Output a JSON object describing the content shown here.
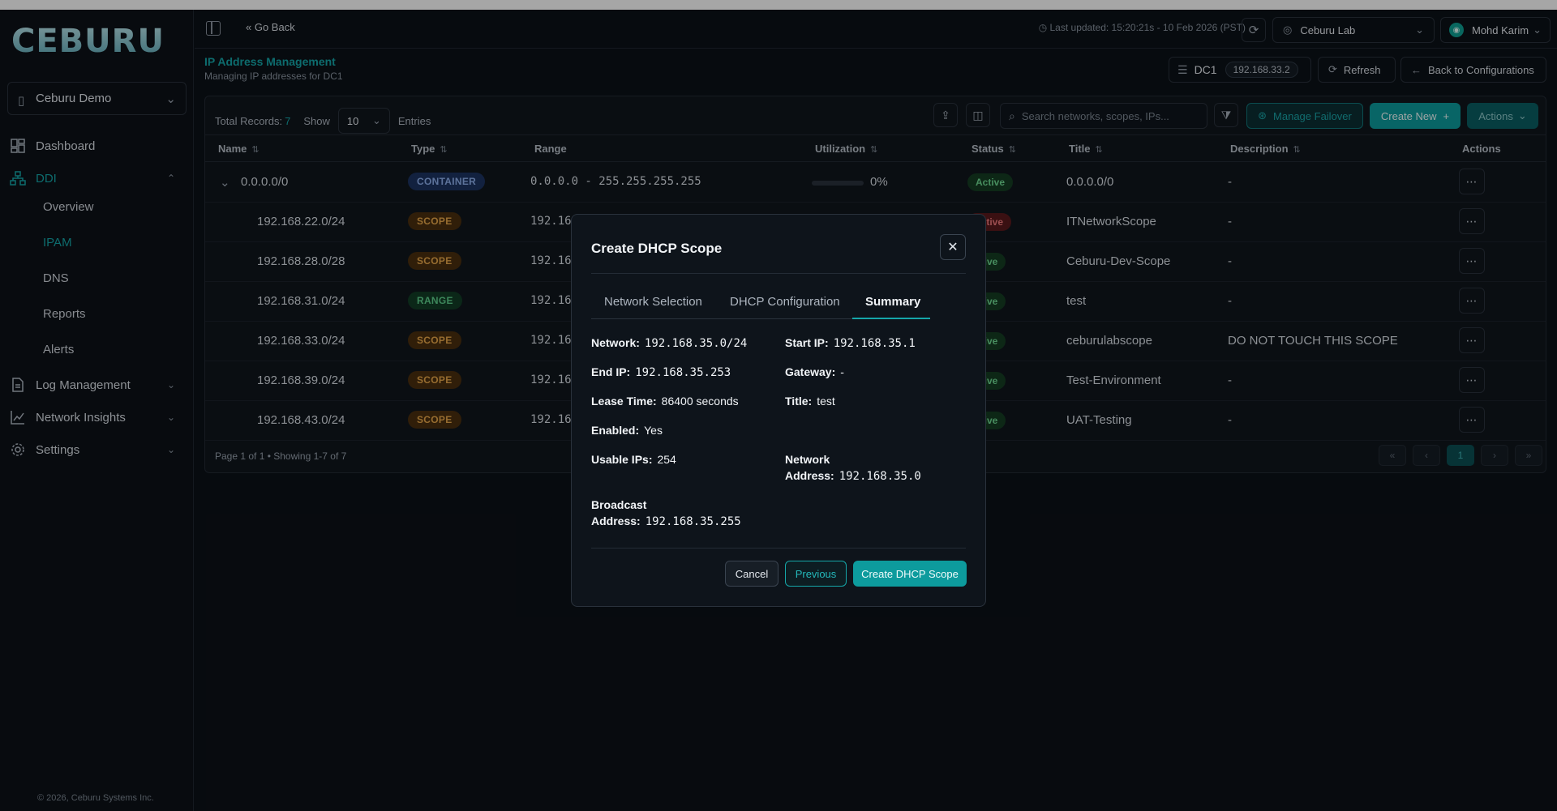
{
  "sidebar": {
    "brand": "CEBURU",
    "org": "Ceburu Demo",
    "items": [
      {
        "label": "Dashboard",
        "icon": "dashboard-icon"
      },
      {
        "label": "DDI",
        "icon": "network-icon"
      },
      {
        "label": "Log Management",
        "icon": "log-icon"
      },
      {
        "label": "Network Insights",
        "icon": "insights-icon"
      },
      {
        "label": "Settings",
        "icon": "gear-icon"
      }
    ],
    "ddi_subitems": [
      "Overview",
      "IPAM",
      "DNS",
      "Reports",
      "Alerts"
    ],
    "copyright": "© 2026, Ceburu Systems Inc."
  },
  "topbar": {
    "go_back": "« Go Back",
    "last_updated": "Last updated: 15:20:21s - 10 Feb 2026 (PST)",
    "lab": "Ceburu Lab",
    "user": "Mohd Karim"
  },
  "page": {
    "title": "IP Address Management",
    "subtitle": "Managing IP addresses for DC1",
    "dc_label": "DC1",
    "dc_ip": "192.168.33.2",
    "refresh": "Refresh",
    "back_to_config": "Back to Configurations"
  },
  "table": {
    "total_label": "Total Records:",
    "total_count": "7",
    "show_label": "Show",
    "show_value": "10",
    "entries_label": "Entries",
    "search_placeholder": "Search networks, scopes, IPs...",
    "manage_failover": "Manage Failover",
    "create_new": "Create New",
    "actions": "Actions",
    "columns": [
      "Name",
      "Type",
      "Range",
      "Utilization",
      "Status",
      "Title",
      "Description",
      "Actions"
    ],
    "rows": [
      {
        "name": "0.0.0.0/0",
        "type": "CONTAINER",
        "range": "0.0.0.0 - 255.255.255.255",
        "utilization": "0%",
        "status": "Active",
        "title": "0.0.0.0/0",
        "description": "-"
      },
      {
        "name": "192.168.22.0/24",
        "type": "SCOPE",
        "range": "192.16",
        "status": "active",
        "title": "ITNetworkScope",
        "description": "-"
      },
      {
        "name": "192.168.28.0/28",
        "type": "SCOPE",
        "range": "192.16",
        "status": "ctive",
        "title": "Ceburu-Dev-Scope",
        "description": "-"
      },
      {
        "name": "192.168.31.0/24",
        "type": "RANGE",
        "range": "192.16",
        "status": "ctive",
        "title": "test",
        "description": "-"
      },
      {
        "name": "192.168.33.0/24",
        "type": "SCOPE",
        "range": "192.16",
        "status": "ctive",
        "title": "ceburulabscope",
        "description": "DO NOT TOUCH THIS SCOPE"
      },
      {
        "name": "192.168.39.0/24",
        "type": "SCOPE",
        "range": "192.16",
        "status": "ctive",
        "title": "Test-Environment",
        "description": "-"
      },
      {
        "name": "192.168.43.0/24",
        "type": "SCOPE",
        "range": "192.16",
        "status": "ctive",
        "title": "UAT-Testing",
        "description": "-"
      }
    ],
    "footer": "Page 1 of 1 • Showing 1-7 of 7",
    "current_page": "1"
  },
  "modal": {
    "title": "Create DHCP Scope",
    "tabs": [
      "Network Selection",
      "DHCP Configuration",
      "Summary"
    ],
    "summary": {
      "network_label": "Network:",
      "network": "192.168.35.0/24",
      "start_label": "Start IP:",
      "start": "192.168.35.1",
      "end_label": "End IP:",
      "end": "192.168.35.253",
      "gateway_label": "Gateway:",
      "gateway": "-",
      "lease_label": "Lease Time:",
      "lease": "86400 seconds",
      "title_label": "Title:",
      "title": "test",
      "enabled_label": "Enabled:",
      "enabled": "Yes",
      "usable_label": "Usable IPs:",
      "usable": "254",
      "netaddr_label_1": "Network",
      "netaddr_label_2": "Address:",
      "netaddr": "192.168.35.0",
      "bcast_label_1": "Broadcast",
      "bcast_label_2": "Address:",
      "bcast": "192.168.35.255"
    },
    "cancel": "Cancel",
    "previous": "Previous",
    "submit": "Create DHCP Scope"
  },
  "colors": {
    "accent": "#15a7a9",
    "background": "#0c1117",
    "scope": "#e9a84a",
    "container": "#8fb1ef",
    "range": "#5fcf8c"
  }
}
